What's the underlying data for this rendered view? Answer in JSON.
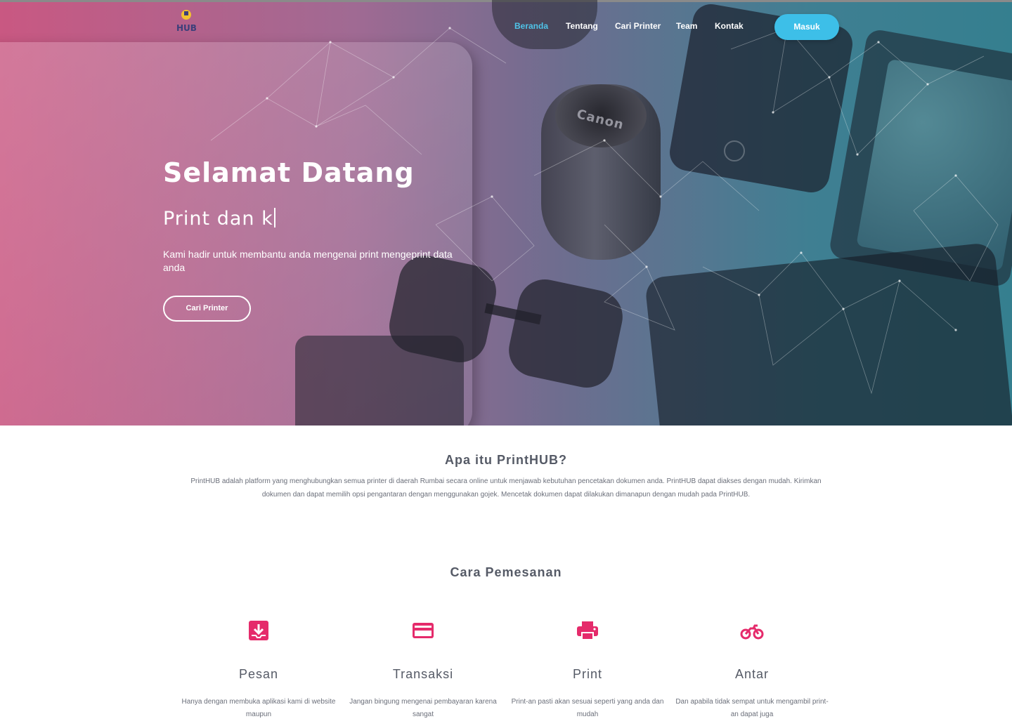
{
  "colors": {
    "accent": "#3dbfe8",
    "icon_pink": "#e52b6b"
  },
  "nav": {
    "logo_icon": "printhub-logo",
    "items": [
      {
        "label": "Beranda",
        "active": true
      },
      {
        "label": "Tentang",
        "active": false
      },
      {
        "label": "Cari Printer",
        "active": false
      },
      {
        "label": "Team",
        "active": false
      },
      {
        "label": "Kontak",
        "active": false
      }
    ],
    "login_label": "Masuk"
  },
  "hero": {
    "title": "Selamat Datang",
    "subtitle": "Print dan k",
    "description": "Kami hadir untuk membantu anda mengenai print mengeprint data anda",
    "cta_label": "Cari Printer"
  },
  "about": {
    "title": "Apa itu PrintHUB?",
    "text": "PrintHUB adalah platform yang menghubungkan semua printer di daerah Rumbai secara online untuk menjawab kebutuhan pencetakan dokumen anda. PrintHUB dapat diakses dengan mudah. Kirimkan dokumen dan dapat memilih opsi pengantaran dengan menggunakan gojek. Mencetak dokumen dapat dilakukan dimanapun dengan mudah pada PrintHUB."
  },
  "steps": {
    "title": "Cara Pemesanan",
    "items": [
      {
        "icon": "inbox-download-icon",
        "name": "Pesan",
        "desc": "Hanya dengan membuka aplikasi kami di website maupun"
      },
      {
        "icon": "credit-card-icon",
        "name": "Transaksi",
        "desc": "Jangan bingung mengenai pembayaran karena sangat"
      },
      {
        "icon": "printer-icon",
        "name": "Print",
        "desc": "Print-an pasti akan sesuai seperti yang anda dan mudah"
      },
      {
        "icon": "motorcycle-icon",
        "name": "Antar",
        "desc": "Dan apabila tidak sempat untuk mengambil print-an dapat juga"
      }
    ]
  }
}
